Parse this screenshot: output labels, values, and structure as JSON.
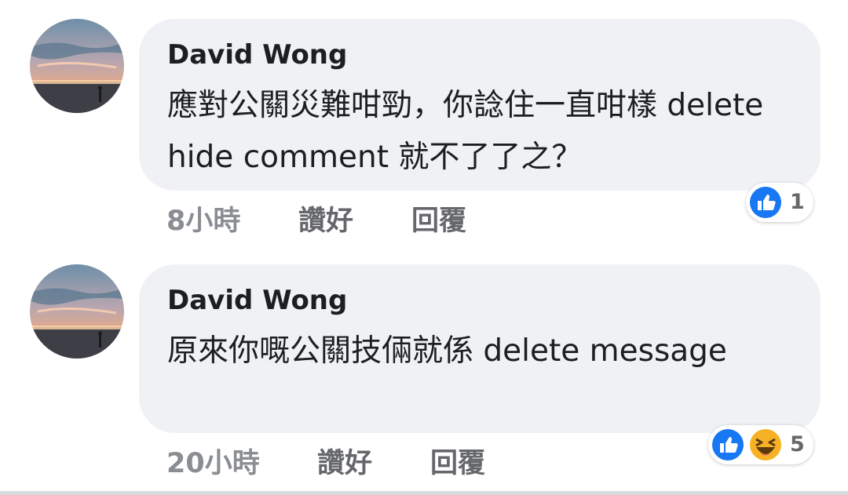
{
  "comments": [
    {
      "author": "David Wong",
      "text": "應對公關災難咁勁，你諗住一直咁樣 delete hide comment 就不了了之？",
      "time": "8小時",
      "like_label": "讚好",
      "reply_label": "回覆",
      "reactions": {
        "icons": [
          "like-icon"
        ],
        "count": "1"
      }
    },
    {
      "author": "David Wong",
      "text": "原來你嘅公關技倆就係 delete message",
      "time": "20小時",
      "like_label": "讚好",
      "reply_label": "回覆",
      "reactions": {
        "icons": [
          "like-icon",
          "haha-icon"
        ],
        "count": "5"
      }
    }
  ],
  "colors": {
    "bubble": "#eff1f4",
    "like_blue": "#1877f2",
    "haha_yellow": "#f7b125",
    "secondary_text": "#65676b"
  }
}
